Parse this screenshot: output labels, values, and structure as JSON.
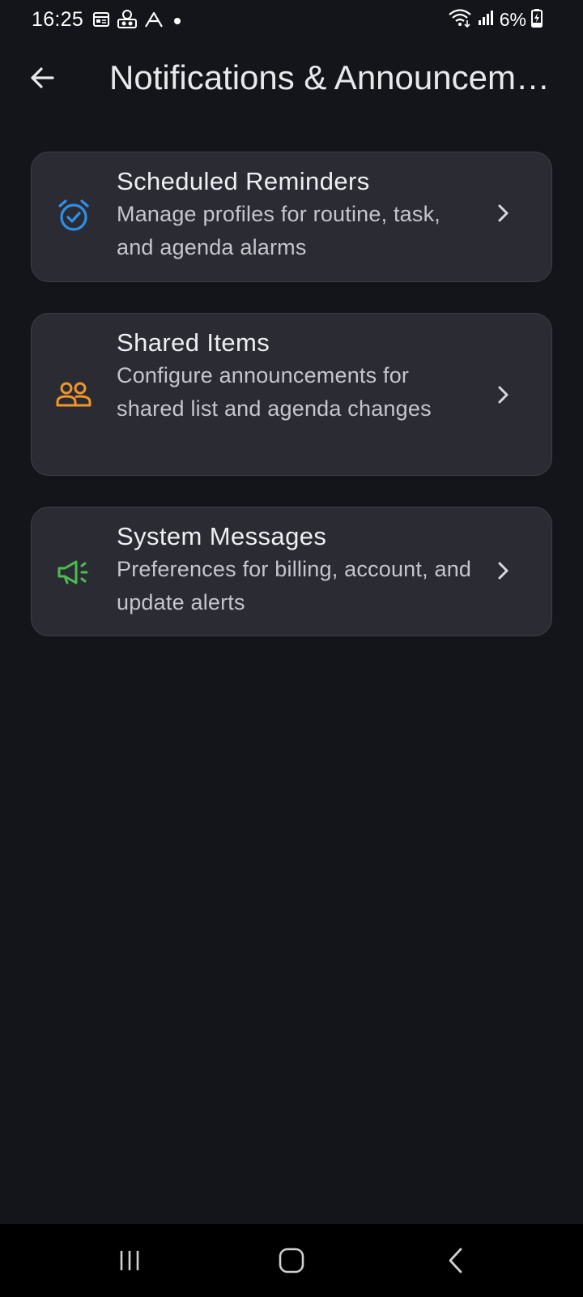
{
  "status_bar": {
    "time": "16:25",
    "battery_percent": "6%",
    "left_icons": [
      "calendar-icon",
      "incognito-icon",
      "arrow-app-icon",
      "dot-icon"
    ],
    "right_icons": [
      "wifi-icon",
      "signal-icon",
      "battery-charging-icon"
    ]
  },
  "app_bar": {
    "title": "Notifications & Announcements",
    "back_icon": "arrow-left-icon"
  },
  "settings": [
    {
      "title": "Scheduled Reminders",
      "description": "Manage profiles for routine, task, and agenda alarms",
      "icon": "alarm-check-icon",
      "icon_color": "#2f8fe8"
    },
    {
      "title": "Shared Items",
      "description": "Configure announcements for shared list and agenda changes",
      "icon": "people-icon",
      "icon_color": "#f0962a"
    },
    {
      "title": "System Messages",
      "description": "Preferences for billing, account, and update alerts",
      "icon": "megaphone-icon",
      "icon_color": "#4cbb50"
    }
  ],
  "nav_bar": {
    "buttons": [
      "recent-apps-icon",
      "home-icon",
      "back-nav-icon"
    ]
  },
  "colors": {
    "background": "#13151a",
    "card": "#2b2c33",
    "text_primary": "#eeeff2",
    "text_secondary": "#c4c6cc"
  }
}
